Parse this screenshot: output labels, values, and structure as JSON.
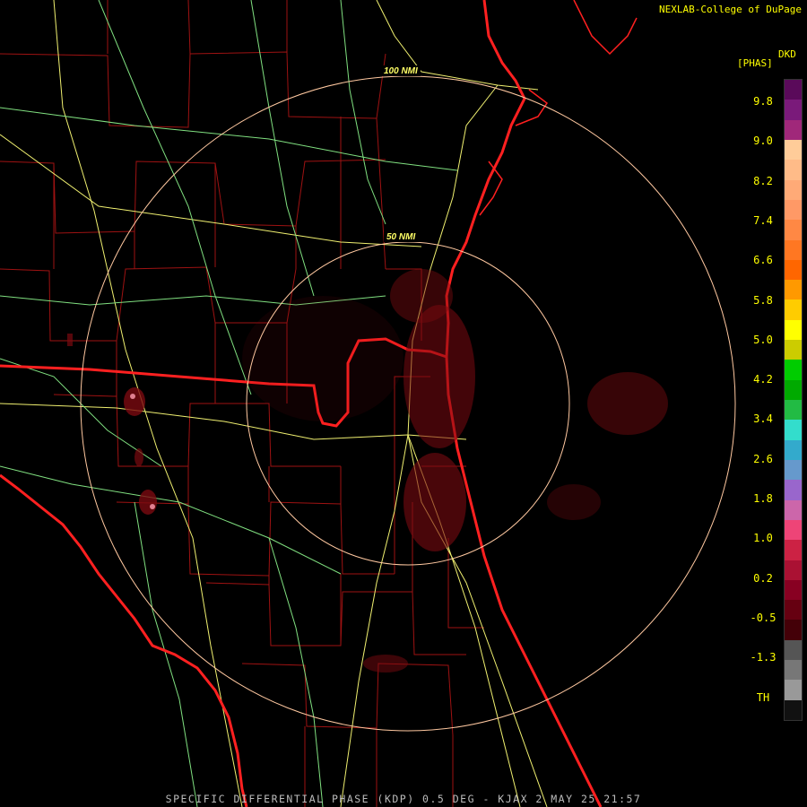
{
  "header": {
    "credit": "NEXLAB-College of DuPage"
  },
  "range_rings": [
    {
      "label": "100 NMI"
    },
    {
      "label": "50 NMI"
    }
  ],
  "legend": {
    "product": "DKD",
    "units": "[PHAS]",
    "labels": [
      "9.8",
      "9.0",
      "8.2",
      "7.4",
      "6.6",
      "5.8",
      "5.0",
      "4.2",
      "3.4",
      "2.6",
      "1.8",
      "1.0",
      "0.2",
      "-0.5",
      "-1.3",
      "TH"
    ],
    "colors": [
      "#5a0a5a",
      "#7a1a7a",
      "#a0287a",
      "#ffcc99",
      "#ffbb88",
      "#ffaa77",
      "#ff9966",
      "#ff8844",
      "#ff7722",
      "#ff6600",
      "#ff9900",
      "#ffcc00",
      "#ffff00",
      "#cccc00",
      "#00cc00",
      "#00aa00",
      "#22bb44",
      "#33ddcc",
      "#33aacc",
      "#6699cc",
      "#9966cc",
      "#cc66aa",
      "#ee4477",
      "#cc2244",
      "#aa1133",
      "#880022",
      "#660011",
      "#440008",
      "#555555",
      "#777777",
      "#999999",
      "#111111"
    ]
  },
  "footer": {
    "caption": "SPECIFIC DIFFERENTIAL PHASE (KDP) 0.5 DEG - KJAX 2 MAY 25 21:57"
  },
  "map": {
    "state_border_color": "#ff2020",
    "county_border_color": "#c01818",
    "highway_color": "#f0f070",
    "road_color": "#80e080",
    "range_ring_color": "#ffc8a0",
    "echo_color": "#7a0a10"
  }
}
